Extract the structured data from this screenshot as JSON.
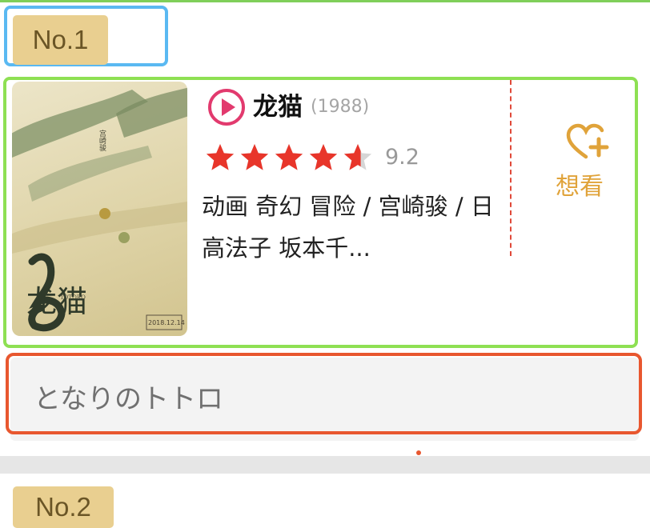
{
  "ranking": [
    {
      "rank_label": "No.1",
      "title": "龙猫",
      "year": "(1988)",
      "rating": 9.2,
      "rating_text": "9.2",
      "stars_out_of_5": 4.6,
      "info": "动画 奇幻 冒险 / 宫崎骏 / 日高法子 坂本千...",
      "action_label": "想看",
      "alias": "となりのトトロ"
    },
    {
      "rank_label": "No.2"
    }
  ],
  "poster": {
    "title_art": "龙猫",
    "title_en": "TOTORO",
    "director": "宫崎骏",
    "release_date": "2018.12.14"
  },
  "colors": {
    "badge_bg": "#e9cf90",
    "play_icon": "#e23a6e",
    "star": "#e8352a",
    "want_action": "#e0a33a",
    "highlight_blue": "#5ab9f2",
    "highlight_green": "#8ee053",
    "highlight_red": "#e8572f"
  },
  "icons": {
    "play": "play-circle-icon",
    "star": "star-icon",
    "want": "heart-plus-icon"
  }
}
